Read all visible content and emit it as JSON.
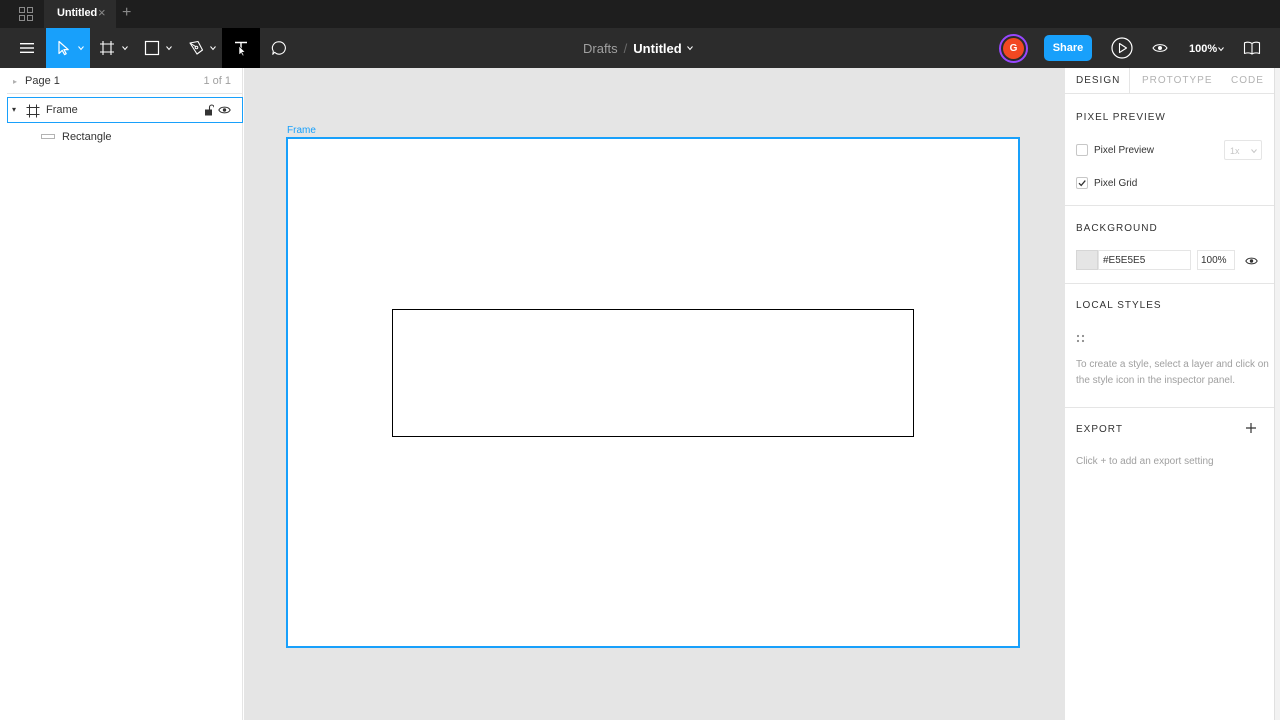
{
  "titlebar": {
    "tab_label": "Untitled",
    "tab_close": "×",
    "new_tab": "+",
    "icons": {
      "home": "grid-icon"
    }
  },
  "toolbar": {
    "tools": [
      "main-menu",
      "move",
      "frame",
      "shape",
      "pen",
      "text",
      "comment"
    ],
    "breadcrumb": {
      "project": "Drafts",
      "separator": "/",
      "file": "Untitled"
    },
    "avatar_initial": "G",
    "share_label": "Share",
    "zoom_label": "100%",
    "colors": {
      "accent": "#18a0fb",
      "avatar": "#f24822",
      "avatar_ring": "#9747ff"
    }
  },
  "layers": {
    "page": {
      "name": "Page 1",
      "count": "1 of 1"
    },
    "items": [
      {
        "name": "Frame",
        "type": "frame",
        "selected": true
      },
      {
        "name": "Rectangle",
        "type": "rectangle",
        "selected": false
      }
    ]
  },
  "canvas": {
    "frame_label": "Frame",
    "background": "#e5e5e5"
  },
  "inspector": {
    "tabs": [
      "DESIGN",
      "PROTOTYPE",
      "CODE"
    ],
    "active_tab": "DESIGN",
    "pixel_preview": {
      "title": "PIXEL PREVIEW",
      "preview_label": "Pixel Preview",
      "preview_checked": false,
      "scale_value": "1x",
      "grid_label": "Pixel Grid",
      "grid_checked": true
    },
    "background": {
      "title": "BACKGROUND",
      "hex": "#E5E5E5",
      "opacity": "100%"
    },
    "local_styles": {
      "title": "LOCAL STYLES",
      "hint": "To create a style, select a layer and click on the style icon in the inspector panel."
    },
    "export": {
      "title": "EXPORT",
      "hint": "Click + to add an export setting"
    }
  }
}
